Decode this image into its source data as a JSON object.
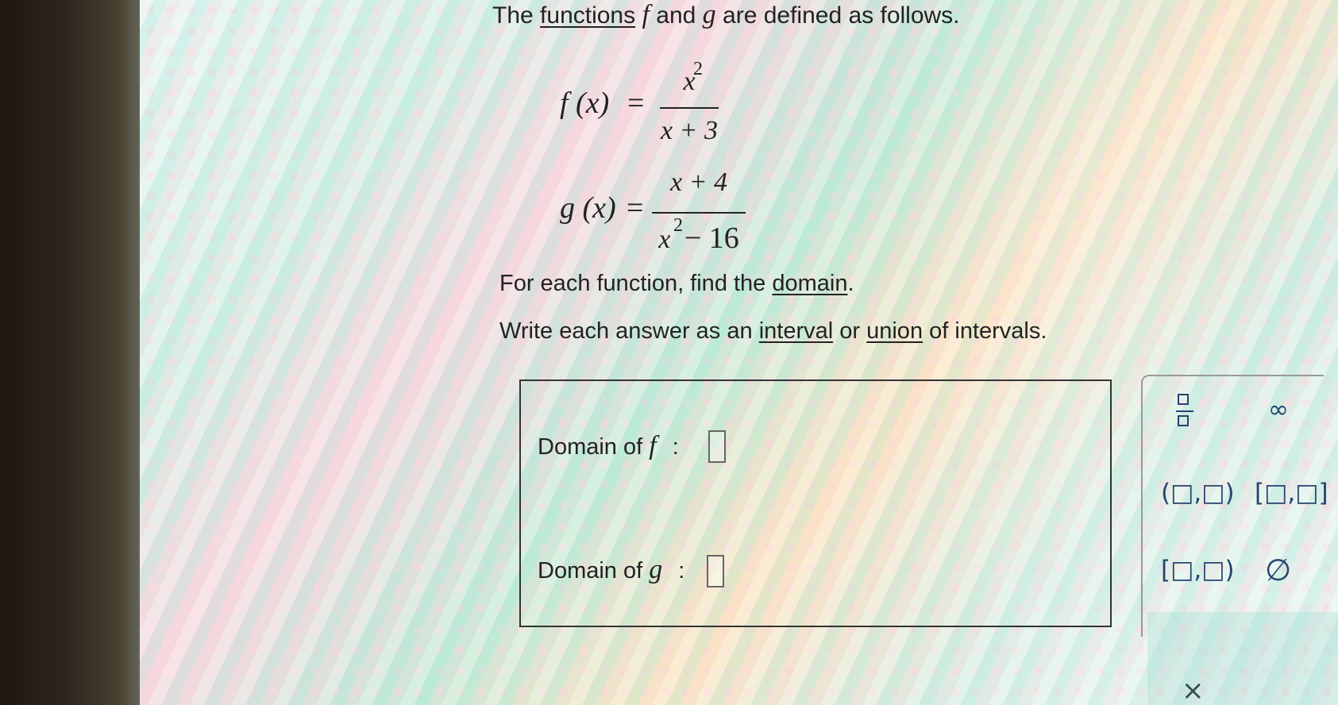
{
  "problem": {
    "intro_text": "The",
    "functions_link": "functions",
    "f_name": "f",
    "and_text": "and",
    "g_name": "g",
    "defined_text": "are defined as follows."
  },
  "definitions": {
    "f": {
      "left": "f (x)",
      "equals": "=",
      "numerator_base": "x",
      "numerator_exponent": "2",
      "denominator": "x + 3"
    },
    "g": {
      "left": "g (x)",
      "equals": "=",
      "numerator": "x + 4",
      "denominator_base": "x",
      "denominator_exponent": "2",
      "denominator_tail": "− 16"
    }
  },
  "instructions": {
    "domain_prefix": "For each function, find the",
    "domain_link": "domain",
    "domain_suffix": ".",
    "answer_prefix": "Write each answer as an",
    "interval_link": "interval",
    "or_text": "or",
    "union_link": "union",
    "answer_suffix": "of intervals."
  },
  "answers": {
    "domain_f_label": "Domain of",
    "domain_f_function": "f",
    "domain_f_colon": ":",
    "domain_g_label": "Domain of",
    "domain_g_function": "g",
    "domain_g_colon": ":"
  },
  "palette": {
    "infinity": "∞",
    "negative_infinity": "-∞",
    "open_open": "(□,□)",
    "closed_closed": "[□,□]",
    "open_closed": "(□,□]",
    "closed_open": "[□,□)",
    "empty_set": "∅",
    "union": "□∪□"
  },
  "controls": {
    "clear": "×",
    "undo": "↶"
  },
  "colors": {
    "text": "#222222",
    "palette_blue": "#25446f",
    "border": "#333333"
  }
}
